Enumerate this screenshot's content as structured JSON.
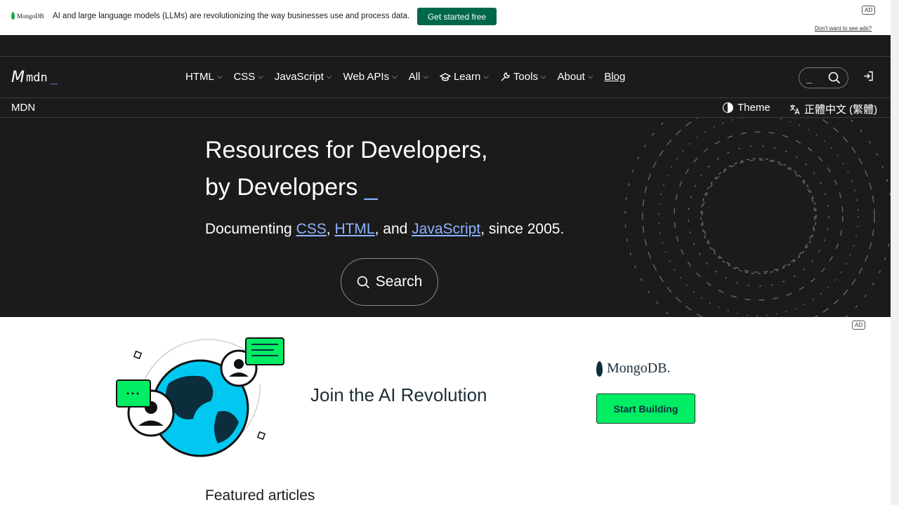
{
  "top_ad": {
    "brand": "MongoDB",
    "text": "AI and large language models (LLMs) are revolutionizing the way businesses use and process data.",
    "cta": "Get started free",
    "badge": "AD",
    "dont_want": "Don't want to see ads?"
  },
  "header": {
    "logo_mark": "M",
    "logo_text": "mdn",
    "logo_cursor": "_",
    "nav": [
      {
        "label": "HTML",
        "icon": ""
      },
      {
        "label": "CSS",
        "icon": ""
      },
      {
        "label": "JavaScript",
        "icon": ""
      },
      {
        "label": "Web APIs",
        "icon": ""
      },
      {
        "label": "All",
        "icon": ""
      },
      {
        "label": "Learn",
        "icon": "graduation-cap-icon"
      },
      {
        "label": "Tools",
        "icon": "wrench-icon"
      },
      {
        "label": "About",
        "icon": ""
      }
    ],
    "blog": "Blog",
    "search_placeholder": "_",
    "breadcrumb": "MDN",
    "theme": "Theme",
    "language": "正體中文 (繁體)"
  },
  "hero": {
    "title_line1": "Resources for Developers,",
    "title_line2": "by Developers",
    "title_cursor": "_",
    "sub_prefix": "Documenting ",
    "sub_css": "CSS",
    "sub_sep1": ", ",
    "sub_html": "HTML",
    "sub_sep2": ", and ",
    "sub_js": "JavaScript",
    "sub_suffix": ", since 2005.",
    "search_label": "Search"
  },
  "ad_section": {
    "badge": "AD",
    "headline": "Join the AI Revolution",
    "brand": "MongoDB.",
    "cta": "Start Building"
  },
  "featured_title": "Featured articles",
  "colors": {
    "header_bg": "#1b1b1c",
    "link": "#8cb4ff",
    "ad_cta": "#00684a",
    "start_btn": "#00ed64"
  }
}
